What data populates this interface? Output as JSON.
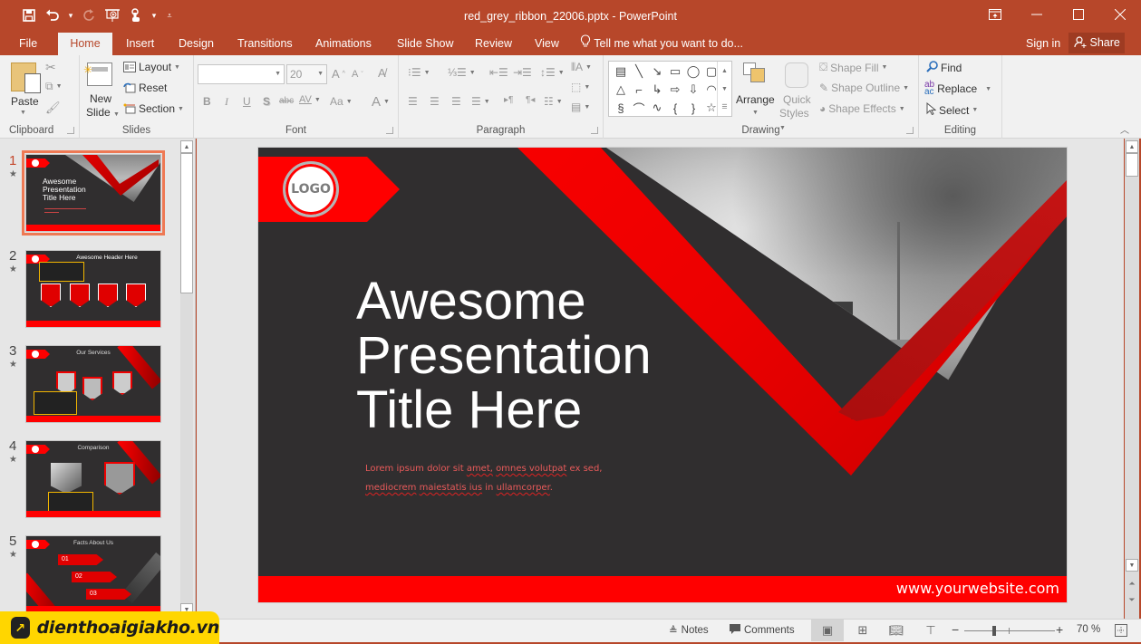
{
  "window": {
    "title": "red_grey_ribbon_22006.pptx - PowerPoint",
    "controls": [
      "ribbon-display-options",
      "minimize",
      "maximize",
      "close"
    ]
  },
  "quick_access": {
    "items": [
      {
        "name": "save",
        "glyph": "🖫"
      },
      {
        "name": "undo",
        "glyph": "↶"
      },
      {
        "name": "redo",
        "glyph": "↻"
      },
      {
        "name": "start-from-beginning",
        "glyph": "⊡"
      },
      {
        "name": "touch-mode",
        "glyph": "☝"
      },
      {
        "name": "customize",
        "glyph": "⩡"
      }
    ]
  },
  "tabs": [
    {
      "label": "File"
    },
    {
      "label": "Home",
      "active": true
    },
    {
      "label": "Insert"
    },
    {
      "label": "Design"
    },
    {
      "label": "Transitions"
    },
    {
      "label": "Animations"
    },
    {
      "label": "Slide Show"
    },
    {
      "label": "Review"
    },
    {
      "label": "View"
    }
  ],
  "tell_me": "Tell me what you want to do...",
  "account": {
    "sign_in": "Sign in",
    "share": "Share"
  },
  "ribbon": {
    "clipboard": {
      "label": "Clipboard",
      "paste": "Paste"
    },
    "slides": {
      "label": "Slides",
      "new_slide": "New\nSlide",
      "new_slide_line1": "New",
      "new_slide_line2": "Slide",
      "layout": "Layout",
      "reset": "Reset",
      "section": "Section"
    },
    "font": {
      "label": "Font",
      "font_name": "",
      "font_size": "20",
      "bold": "B",
      "italic": "I",
      "underline": "U",
      "shadow": "S",
      "strike": "abc",
      "spacing": "AV",
      "case": "Aa",
      "color": "A"
    },
    "paragraph": {
      "label": "Paragraph"
    },
    "drawing": {
      "label": "Drawing",
      "arrange": "Arrange",
      "quick_styles_line1": "Quick",
      "quick_styles_line2": "Styles",
      "shape_fill": "Shape Fill",
      "shape_outline": "Shape Outline",
      "shape_effects": "Shape Effects",
      "shapes": [
        "▤",
        "╲",
        "↘",
        "▭",
        "◯",
        "▢",
        "△",
        "⌐",
        "↳",
        "⇨",
        "⇩",
        "◠",
        "§",
        "⌒",
        "∿",
        "{",
        "}",
        "☆"
      ]
    },
    "editing": {
      "label": "Editing",
      "find": "Find",
      "replace": "Replace",
      "select": "Select"
    }
  },
  "thumbnails": [
    {
      "number": "1",
      "title": "Awesome\nPresentation\nTitle Here",
      "title_lines": [
        "Awesome",
        "Presentation",
        "Title Here"
      ],
      "selected": true
    },
    {
      "number": "2",
      "heading": "Awesome Header Here"
    },
    {
      "number": "3",
      "heading": "Our Services"
    },
    {
      "number": "4",
      "heading": "Comparison"
    },
    {
      "number": "5",
      "heading": "Facts About Us",
      "items": [
        "01",
        "02",
        "03"
      ]
    }
  ],
  "slide": {
    "logo": "LOGO",
    "title_lines": [
      "Awesome",
      "Presentation",
      "Title Here"
    ],
    "subtitle_parts": [
      {
        "text": "Lorem ipsum dolor sit ",
        "misspelled": false
      },
      {
        "text": "amet,",
        "misspelled": true
      },
      {
        "text": " ",
        "misspelled": false
      },
      {
        "text": "omnes volutpat",
        "misspelled": true
      },
      {
        "text": " ex sed, ",
        "misspelled": false
      },
      {
        "text": "mediocrem",
        "misspelled": true
      },
      {
        "text": " ",
        "misspelled": false
      },
      {
        "text": "maiestatis ius",
        "misspelled": true
      },
      {
        "text": " in ",
        "misspelled": false
      },
      {
        "text": "ullamcorper",
        "misspelled": true
      },
      {
        "text": ".",
        "misspelled": false
      }
    ],
    "website": "www.yourwebsite.com",
    "colors": {
      "background": "#302e2f",
      "accent": "#ff0000"
    }
  },
  "status_bar": {
    "notes": "Notes",
    "comments": "Comments",
    "zoom_percent": "70 %",
    "zoom_value": 70,
    "view_active": "normal"
  },
  "watermark": {
    "text": "dienthoaigiakho.vn"
  }
}
